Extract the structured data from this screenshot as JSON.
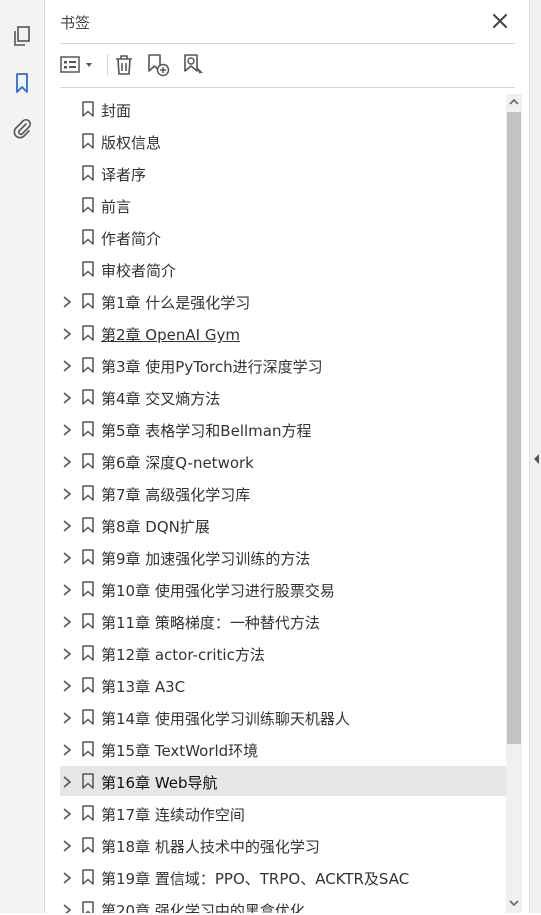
{
  "panel": {
    "title": "书签"
  },
  "bookmarks": [
    {
      "label": "封面",
      "expandable": false
    },
    {
      "label": "版权信息",
      "expandable": false
    },
    {
      "label": "译者序",
      "expandable": false
    },
    {
      "label": "前言",
      "expandable": false
    },
    {
      "label": "作者简介",
      "expandable": false
    },
    {
      "label": "审校者简介",
      "expandable": false
    },
    {
      "label": "第1章 什么是强化学习",
      "expandable": true
    },
    {
      "label": "第2章 OpenAI Gym",
      "expandable": true,
      "hovered": true
    },
    {
      "label": "第3章 使用PyTorch进行深度学习",
      "expandable": true
    },
    {
      "label": "第4章 交叉熵方法",
      "expandable": true
    },
    {
      "label": "第5章 表格学习和Bellman方程",
      "expandable": true
    },
    {
      "label": "第6章 深度Q-network",
      "expandable": true
    },
    {
      "label": "第7章 高级强化学习库",
      "expandable": true
    },
    {
      "label": "第8章 DQN扩展",
      "expandable": true
    },
    {
      "label": "第9章 加速强化学习训练的方法",
      "expandable": true
    },
    {
      "label": "第10章 使用强化学习进行股票交易",
      "expandable": true
    },
    {
      "label": "第11章 策略梯度：一种替代方法",
      "expandable": true
    },
    {
      "label": "第12章 actor-critic方法",
      "expandable": true
    },
    {
      "label": "第13章 A3C",
      "expandable": true
    },
    {
      "label": "第14章 使用强化学习训练聊天机器人",
      "expandable": true
    },
    {
      "label": "第15章 TextWorld环境",
      "expandable": true
    },
    {
      "label": "第16章 Web导航",
      "expandable": true,
      "selected": true
    },
    {
      "label": "第17章 连续动作空间",
      "expandable": true
    },
    {
      "label": "第18章 机器人技术中的强化学习",
      "expandable": true
    },
    {
      "label": "第19章 置信域：PPO、TRPO、ACKTR及SAC",
      "expandable": true
    },
    {
      "label": "第20章 强化学习中的黑盒优化",
      "expandable": true
    }
  ],
  "colors": {
    "accent": "#2a6fc9",
    "selected_row": "#e6e6e6",
    "icon": "#555555"
  }
}
